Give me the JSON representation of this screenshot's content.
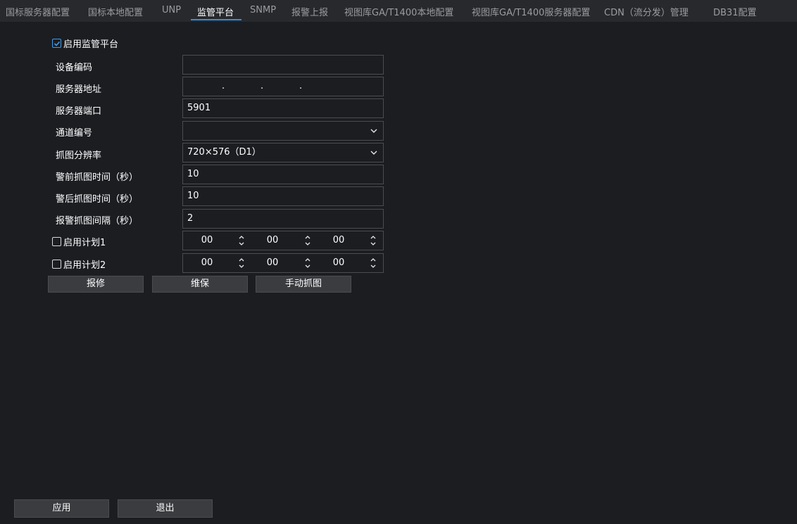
{
  "tabs": [
    {
      "label": "国标服务器配置"
    },
    {
      "label": "国标本地配置"
    },
    {
      "label": "UNP"
    },
    {
      "label": "监管平台"
    },
    {
      "label": "SNMP"
    },
    {
      "label": "报警上报"
    },
    {
      "label": "视图库GA/T1400本地配置"
    },
    {
      "label": "视图库GA/T1400服务器配置"
    },
    {
      "label": "CDN（流分发）管理"
    },
    {
      "label": "DB31配置"
    }
  ],
  "active_tab": "监管平台",
  "enable_platform": {
    "label": "启用监管平台",
    "checked": true
  },
  "form": {
    "device_code": {
      "label": "设备编码",
      "value": ""
    },
    "server_address": {
      "label": "服务器地址",
      "value": ". . ."
    },
    "server_port": {
      "label": "服务器端口",
      "value": "5901"
    },
    "channel_no": {
      "label": "通道编号",
      "value": ""
    },
    "snapshot_resolution": {
      "label": "抓图分辨率",
      "value": "720×576（D1）"
    },
    "pre_alarm_time": {
      "label": "警前抓图时间（秒）",
      "value": "10"
    },
    "post_alarm_time": {
      "label": "警后抓图时间（秒）",
      "value": "10"
    },
    "alarm_interval": {
      "label": "报警抓图间隔（秒）",
      "value": "2"
    }
  },
  "schedule1": {
    "label": "启用计划1",
    "checked": false,
    "h": "00",
    "m": "00",
    "s": "00"
  },
  "schedule2": {
    "label": "启用计划2",
    "checked": false,
    "h": "00",
    "m": "00",
    "s": "00"
  },
  "actions": {
    "repair": "报修",
    "maintain": "维保",
    "manual_snapshot": "手动抓图"
  },
  "footer": {
    "apply": "应用",
    "exit": "退出"
  },
  "colors": {
    "accent": "#2f8fe0",
    "background": "#1b1d21",
    "tabbar": "#27292d"
  }
}
